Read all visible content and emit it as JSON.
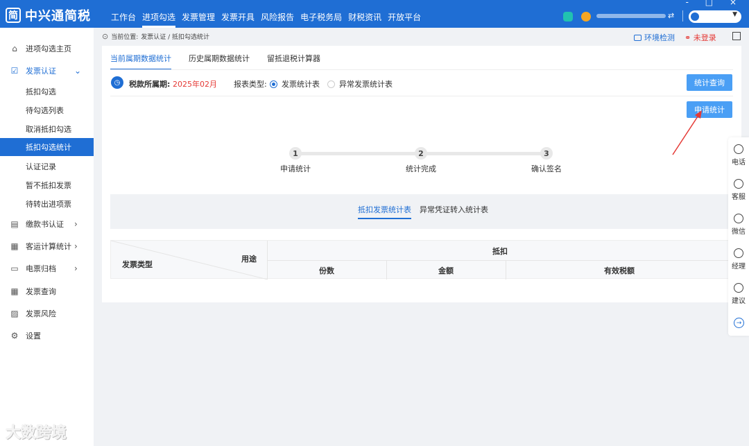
{
  "app": {
    "logo_text": "中兴通简税",
    "logo_glyph": "简"
  },
  "topnav": [
    {
      "label": "工作台",
      "active": false
    },
    {
      "label": "进项勾选",
      "active": true
    },
    {
      "label": "发票管理",
      "active": false
    },
    {
      "label": "发票开具",
      "active": false
    },
    {
      "label": "风险报告",
      "active": false
    },
    {
      "label": "电子税务局",
      "active": false
    },
    {
      "label": "财税资讯",
      "active": false
    },
    {
      "label": "开放平台",
      "active": false
    }
  ],
  "window_controls": "- □ ×",
  "sidebar": {
    "items": [
      {
        "label": "进项勾选主页",
        "icon": "home-icon",
        "glyph": "⌂"
      },
      {
        "label": "发票认证",
        "icon": "check-square-icon",
        "glyph": "☑",
        "arrow": "⌄"
      },
      {
        "label": "抵扣勾选"
      },
      {
        "label": "待勾选列表"
      },
      {
        "label": "取消抵扣勾选"
      },
      {
        "label": "抵扣勾选统计"
      },
      {
        "label": "认证记录"
      },
      {
        "label": "暂不抵扣发票"
      },
      {
        "label": "待转出进项票"
      },
      {
        "label": "缴款书认证",
        "icon": "document-icon",
        "glyph": "▤",
        "arrow": "›"
      },
      {
        "label": "客运计算统计",
        "icon": "calc-icon",
        "glyph": "▦",
        "arrow": "›"
      },
      {
        "label": "电票归档",
        "icon": "archive-icon",
        "glyph": "▭",
        "arrow": "›"
      },
      {
        "label": "发票查询",
        "icon": "grid-icon",
        "glyph": "▦"
      },
      {
        "label": "发票风险",
        "icon": "chart-icon",
        "glyph": "▨"
      },
      {
        "label": "设置",
        "icon": "gear-icon",
        "glyph": "⚙"
      }
    ]
  },
  "breadcrumb": {
    "prefix": "当前位置:",
    "path": "发票认证 / 抵扣勾选统计"
  },
  "header_actions": {
    "env_check": "环境检测",
    "login_status": "未登录"
  },
  "tabs": [
    "当前属期数据统计",
    "历史属期数据统计",
    "留抵退税计算器"
  ],
  "period": {
    "label": "税款所属期:",
    "value": "2025年02月"
  },
  "report_type": {
    "label": "报表类型:",
    "options": [
      "发票统计表",
      "异常发票统计表"
    ],
    "selected": "发票统计表"
  },
  "buttons": {
    "query": "统计查询",
    "apply": "申请统计"
  },
  "steps": [
    {
      "num": "1",
      "label": "申请统计"
    },
    {
      "num": "2",
      "label": "统计完成"
    },
    {
      "num": "3",
      "label": "确认签名"
    }
  ],
  "subtabs": [
    "抵扣发票统计表",
    "异常凭证转入统计表"
  ],
  "table": {
    "corner_top": "用途",
    "corner_bottom": "发票类型",
    "group_header": "抵扣",
    "columns": [
      "份数",
      "金额",
      "有效税额"
    ]
  },
  "float_menu": [
    "电话",
    "客服",
    "微信",
    "经理",
    "建议"
  ],
  "colors": {
    "primary": "#1f6ed4",
    "button": "#4a9ff5",
    "alert": "#e53935"
  },
  "watermark": "大数跨境"
}
